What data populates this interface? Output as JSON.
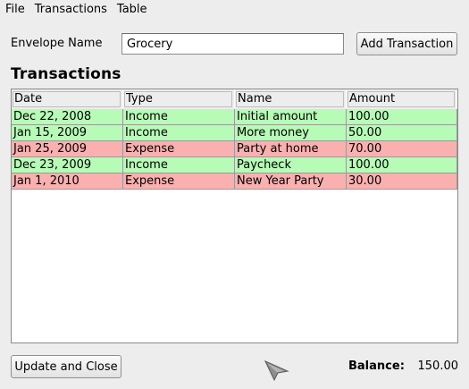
{
  "menu": [
    "File",
    "Transactions",
    "Table"
  ],
  "envelope": {
    "label": "Envelope Name",
    "value": "Grocery"
  },
  "add_button": "Add Transaction",
  "section_title": "Transactions",
  "table": {
    "columns": [
      "Date",
      "Type",
      "Name",
      "Amount"
    ],
    "rows": [
      {
        "cells": [
          "Dec 22, 2008",
          "Income",
          "Initial amount",
          "100.00"
        ],
        "kind": "income"
      },
      {
        "cells": [
          "Jan 15, 2009",
          "Income",
          "More money",
          "50.00"
        ],
        "kind": "income"
      },
      {
        "cells": [
          "Jan 25, 2009",
          "Expense",
          "Party at home",
          "70.00"
        ],
        "kind": "expense"
      },
      {
        "cells": [
          "Dec 23, 2009",
          "Income",
          "Paycheck",
          "100.00"
        ],
        "kind": "income"
      },
      {
        "cells": [
          "Jan 1, 2010",
          "Expense",
          "New Year Party",
          "30.00"
        ],
        "kind": "expense"
      }
    ]
  },
  "colors": {
    "income": "#b6fbb6",
    "expense": "#fbb0b0"
  },
  "update_button": "Update and Close",
  "balance": {
    "label": "Balance:",
    "value": "150.00"
  }
}
